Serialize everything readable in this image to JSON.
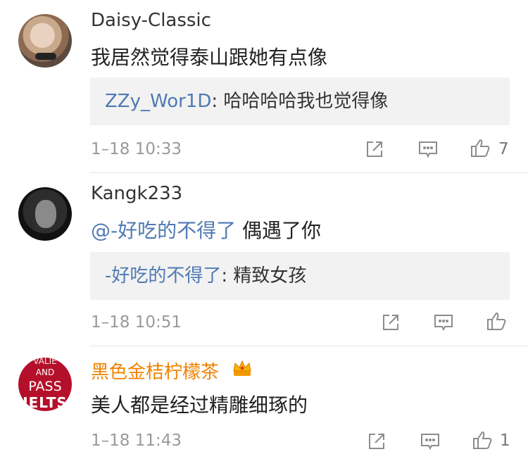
{
  "comments": [
    {
      "username": "Daisy-Classic",
      "text": "我居然觉得泰山跟她有点像",
      "reply": {
        "user": "ZZy_Wor1D",
        "sep": ": ",
        "text": "哈哈哈哈我也觉得像"
      },
      "time": "1–18 10:33",
      "like_count": "7",
      "avatar_icon": "woman-portrait-avatar"
    },
    {
      "username": "Kangk233",
      "mention": "@-好吃的不得了",
      "text": " 偶遇了你",
      "reply": {
        "user": "-好吃的不得了",
        "sep": ": ",
        "text": "精致女孩"
      },
      "time": "1–18 10:51",
      "like_count": "",
      "avatar_icon": "man-portrait-avatar"
    },
    {
      "username": "黑色金桔柠檬茶",
      "text": "美人都是经过精雕细琢的",
      "time": "1–18 11:43",
      "like_count": "1",
      "avatar_icon": "pass-ielts-avatar",
      "avatar_text": {
        "l0": "VALIE",
        "l1": "AND",
        "l2": "PASS",
        "l3": "IELTS"
      },
      "badge_icon": "crown-icon"
    }
  ],
  "colors": {
    "link": "#4f7ab3",
    "vip_name": "#f08200",
    "meta": "#9a9a9a",
    "reply_bg": "#f2f2f2"
  },
  "icons": [
    "share-icon",
    "comment-icon",
    "like-icon"
  ]
}
